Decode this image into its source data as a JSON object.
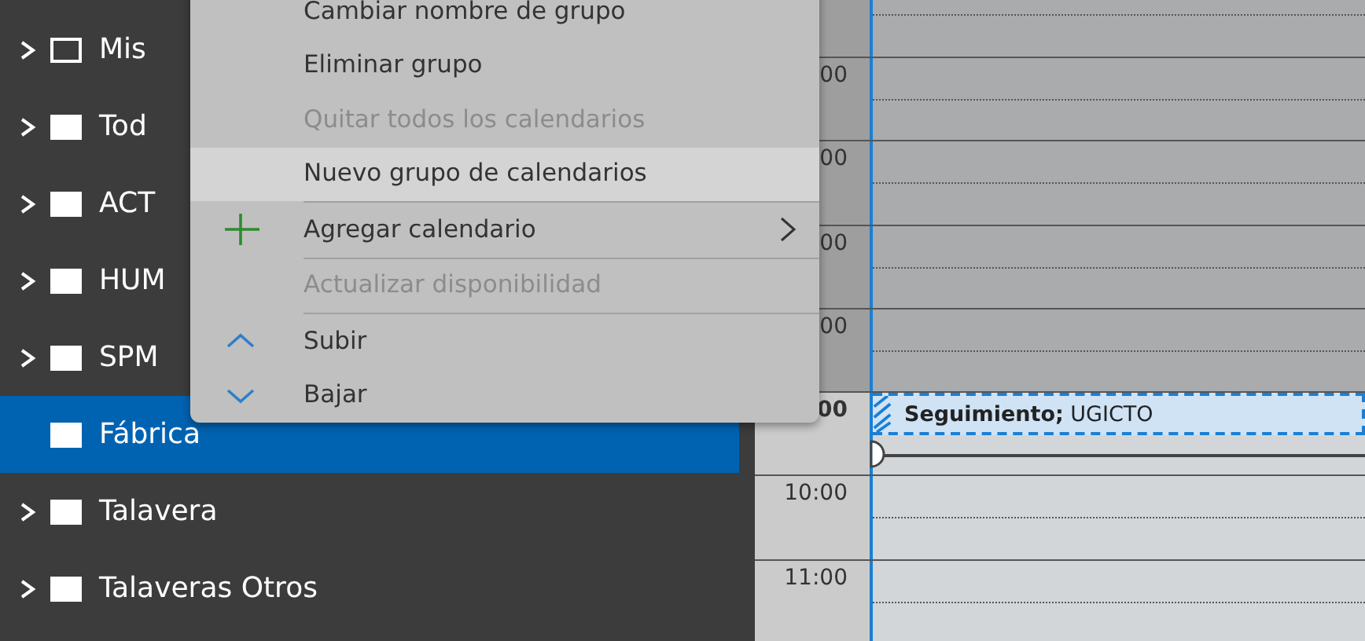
{
  "sidebar": {
    "items": [
      {
        "label": "Mis",
        "checked": false,
        "expandable": true,
        "selected": false
      },
      {
        "label": "Tod",
        "checked": true,
        "expandable": true,
        "selected": false
      },
      {
        "label": "ACT",
        "checked": true,
        "expandable": true,
        "selected": false
      },
      {
        "label": "HUM",
        "checked": true,
        "expandable": true,
        "selected": false
      },
      {
        "label": "SPM",
        "checked": true,
        "expandable": true,
        "selected": false
      },
      {
        "label": "Fábrica",
        "checked": true,
        "expandable": false,
        "selected": true
      },
      {
        "label": "Talavera",
        "checked": true,
        "expandable": true,
        "selected": false
      },
      {
        "label": "Talaveras Otros",
        "checked": true,
        "expandable": true,
        "selected": false
      }
    ]
  },
  "context_menu": {
    "items": [
      {
        "kind": "item",
        "label": "Cambiar nombre de grupo",
        "disabled": false,
        "selected": false
      },
      {
        "kind": "item",
        "label": "Eliminar grupo",
        "disabled": false,
        "selected": false
      },
      {
        "kind": "item",
        "label": "Quitar todos los calendarios",
        "disabled": true,
        "selected": false
      },
      {
        "kind": "item",
        "label": "Nuevo grupo de calendarios",
        "disabled": false,
        "selected": true
      },
      {
        "kind": "separator"
      },
      {
        "kind": "add",
        "label": "Agregar calendario",
        "disabled": false,
        "selected": false,
        "submenu": true
      },
      {
        "kind": "separator"
      },
      {
        "kind": "item",
        "label": "Actualizar disponibilidad",
        "disabled": true,
        "selected": false
      },
      {
        "kind": "separator"
      },
      {
        "kind": "move_up",
        "label": "Subir",
        "disabled": false,
        "selected": false
      },
      {
        "kind": "move_down",
        "label": "Bajar",
        "disabled": false,
        "selected": false
      }
    ]
  },
  "calendar": {
    "rows": [
      {
        "time": "00",
        "working": false,
        "current": false
      },
      {
        "time": "00",
        "working": false,
        "current": false
      },
      {
        "time": "00",
        "working": false,
        "current": false
      },
      {
        "time": "00",
        "working": false,
        "current": false
      },
      {
        "time": "00",
        "working": true,
        "current": true,
        "event": "**Seguimiento;** UGICTO"
      },
      {
        "time": "10:00",
        "working": true,
        "current": false
      },
      {
        "time": "11:00",
        "working": true,
        "current": false
      }
    ]
  }
}
